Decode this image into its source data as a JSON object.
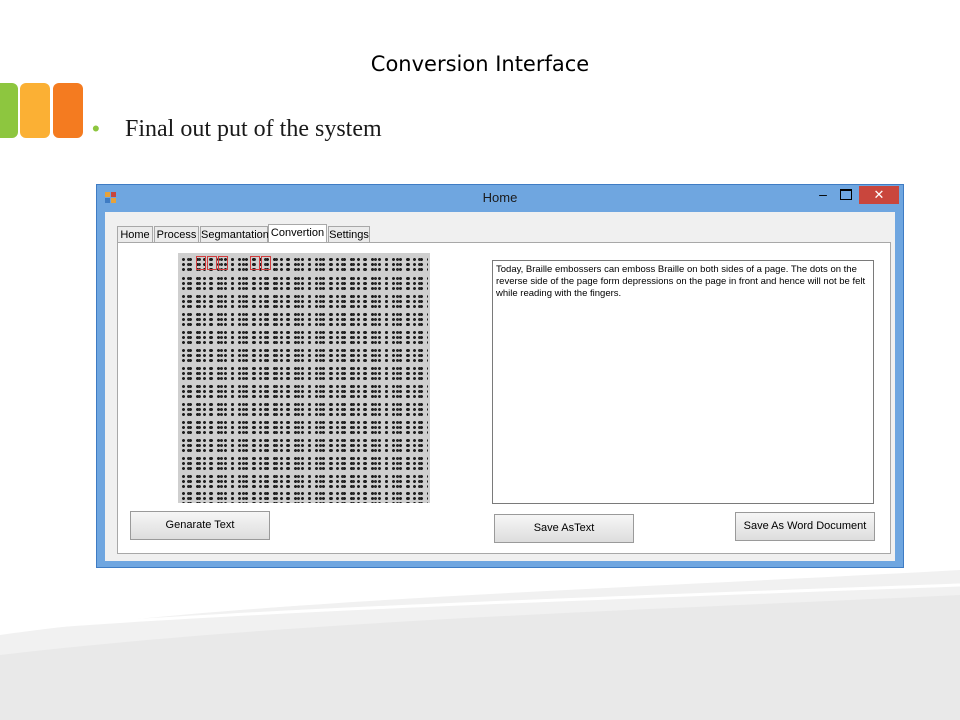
{
  "slide": {
    "title": "Conversion Interface",
    "bullet": "Final out put of the system"
  },
  "window": {
    "title": "Home",
    "minimize_glyph": "–",
    "close_glyph": "✕",
    "tabs": [
      "Home",
      "Process",
      "Segmantation",
      "Convertion",
      "Settings"
    ],
    "active_tab": "Convertion",
    "output_text": "Today, Braille embossers can emboss Braille on both sides of a page. The dots on the reverse side of the page form depressions on the page in front and hence will not be felt while reading with the fingers.",
    "buttons": {
      "generate": "Genarate Text",
      "save_text": "Save AsText",
      "save_word": "Save As Word Document"
    }
  },
  "colors": {
    "accent_green": "#8dc63f",
    "accent_yellow": "#fbb034",
    "accent_orange": "#f47b20",
    "window_frame": "#6fa6e0",
    "close_button": "#c9463d"
  },
  "icons": [
    "app-icon",
    "minimize-icon",
    "maximize-icon",
    "close-icon",
    "bullet-icon"
  ]
}
